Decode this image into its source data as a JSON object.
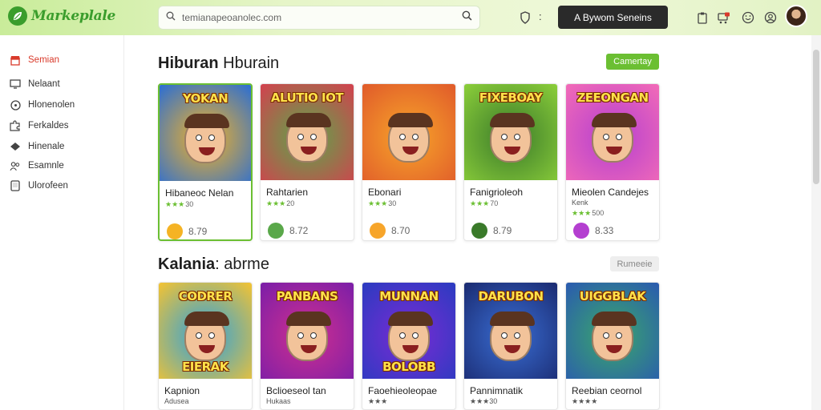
{
  "app": {
    "logo_text": "Markeplale"
  },
  "search": {
    "value": "temianapeoanolec.com"
  },
  "topbar": {
    "primary_button": "A Bywom Seneins"
  },
  "sidebar": {
    "items": [
      {
        "label": "Semian",
        "icon": "store-icon",
        "active": true
      },
      {
        "label": "Nelaant",
        "icon": "monitor-icon",
        "active": false
      },
      {
        "label": "Hlonenolen",
        "icon": "compass-icon",
        "active": false
      },
      {
        "label": "Ferkaldes",
        "icon": "puzzle-icon",
        "active": false
      },
      {
        "label": "Hinenale",
        "icon": "gamepad-icon",
        "active": false
      },
      {
        "label": "Esamnle",
        "icon": "users-icon",
        "active": false
      },
      {
        "label": "Ulorofeen",
        "icon": "tablet-icon",
        "active": false
      }
    ]
  },
  "sections": [
    {
      "title_bold": "Hiburan",
      "title_light": "Hburain",
      "button": "Camertay",
      "cards": [
        {
          "banner": "YOKAN",
          "title": "Hibaneoc Nelan",
          "rating": "★★★",
          "rating_num": "30",
          "price": "8.79",
          "colors": [
            "#f5b324",
            "#2a6ed4"
          ],
          "selected": true
        },
        {
          "banner": "ALUTIO IOT",
          "title": "Rahtarien",
          "rating": "★★★",
          "rating_num": "20",
          "price": "8.72",
          "colors": [
            "#5aa84a",
            "#d4404e"
          ],
          "selected": false
        },
        {
          "banner": "",
          "title": "Ebonari",
          "rating": "★★★",
          "rating_num": "30",
          "price": "8.70",
          "colors": [
            "#f7a52a",
            "#e05a2a"
          ],
          "selected": false
        },
        {
          "banner": "FIXEBOAY",
          "title": "Fanigrioleoh",
          "rating": "★★★",
          "rating_num": "70",
          "price": "8.79",
          "colors": [
            "#3a7a2a",
            "#8ccf3a"
          ],
          "selected": false
        },
        {
          "banner": "ZEEONGAN",
          "title": "Mieolen Candejes",
          "subtitle": "Kenk",
          "rating": "★★★",
          "rating_num": "500",
          "price": "8.33",
          "colors": [
            "#b43fd0",
            "#f36bb7"
          ],
          "selected": false
        }
      ]
    },
    {
      "title_bold": "Kalania",
      "title_light": ": abrme",
      "button": "Rumeeie",
      "cards": [
        {
          "banner": "CODRER",
          "banner2": "EIERAK",
          "title": "Kapnion",
          "subtitle": "Adusea",
          "colors": [
            "#2aa0e0",
            "#f5c331"
          ]
        },
        {
          "banner": "PANBANS",
          "title": "Bclioeseol tan",
          "subtitle": "Hukaas",
          "colors": [
            "#d02f8f",
            "#7a1ea8"
          ]
        },
        {
          "banner": "MUNNAN",
          "banner2": "BOLOBB",
          "title": "Faoehieoleopae",
          "subtitle": "★★★",
          "colors": [
            "#7a2bd4",
            "#2a3bc0"
          ]
        },
        {
          "banner": "DARUBON",
          "title": "Pannimnatik",
          "subtitle": "★★★30",
          "colors": [
            "#3a6ed4",
            "#1a2a70"
          ]
        },
        {
          "banner": "UIGGBLAK",
          "title": "Reebian ceornol",
          "subtitle": "★★★★",
          "colors": [
            "#3aa86a",
            "#2a5ab0"
          ]
        }
      ]
    }
  ]
}
